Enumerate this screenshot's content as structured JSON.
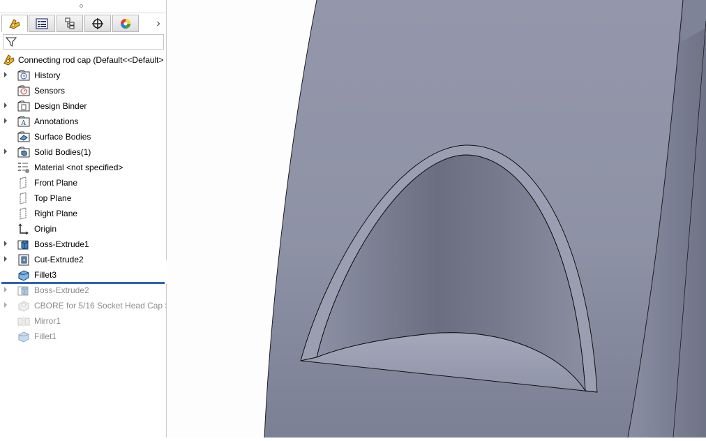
{
  "feature_manager": {
    "tabs": [
      {
        "name": "FeatureManager design tree",
        "icon": "feature-tree-icon"
      },
      {
        "name": "PropertyManager",
        "icon": "property-manager-icon"
      },
      {
        "name": "ConfigurationManager",
        "icon": "configuration-manager-icon"
      },
      {
        "name": "DimXpertManager",
        "icon": "dimxpert-icon"
      },
      {
        "name": "DisplayManager",
        "icon": "display-manager-icon"
      }
    ],
    "more_tabs_glyph": "›",
    "filter_icon": "filter-icon",
    "root_label": "Connecting rod cap  (Default<<Default>",
    "items": [
      {
        "label": "History",
        "icon": "history-folder-icon",
        "expandable": true,
        "suppressed": false
      },
      {
        "label": "Sensors",
        "icon": "sensors-folder-icon",
        "expandable": false,
        "suppressed": false
      },
      {
        "label": "Design Binder",
        "icon": "design-binder-icon",
        "expandable": true,
        "suppressed": false
      },
      {
        "label": "Annotations",
        "icon": "annotations-icon",
        "expandable": true,
        "suppressed": false
      },
      {
        "label": "Surface Bodies",
        "icon": "surface-bodies-icon",
        "expandable": false,
        "suppressed": false
      },
      {
        "label": "Solid Bodies(1)",
        "icon": "solid-bodies-icon",
        "expandable": true,
        "suppressed": false
      },
      {
        "label": "Material <not specified>",
        "icon": "material-icon",
        "expandable": false,
        "suppressed": false
      },
      {
        "label": "Front Plane",
        "icon": "plane-icon",
        "expandable": false,
        "suppressed": false
      },
      {
        "label": "Top Plane",
        "icon": "plane-icon",
        "expandable": false,
        "suppressed": false
      },
      {
        "label": "Right Plane",
        "icon": "plane-icon",
        "expandable": false,
        "suppressed": false
      },
      {
        "label": "Origin",
        "icon": "origin-icon",
        "expandable": false,
        "suppressed": false
      },
      {
        "label": "Boss-Extrude1",
        "icon": "boss-extrude-icon",
        "expandable": true,
        "suppressed": false
      },
      {
        "label": "Cut-Extrude2",
        "icon": "cut-extrude-icon",
        "expandable": true,
        "suppressed": false
      },
      {
        "label": "Fillet3",
        "icon": "fillet-icon",
        "expandable": false,
        "suppressed": false
      },
      {
        "label": "Boss-Extrude2",
        "icon": "boss-extrude-icon",
        "expandable": true,
        "suppressed": true
      },
      {
        "label": "CBORE for 5/16 Socket Head Cap Sc",
        "icon": "hole-wizard-icon",
        "expandable": true,
        "suppressed": true
      },
      {
        "label": "Mirror1",
        "icon": "mirror-icon",
        "expandable": false,
        "suppressed": true
      },
      {
        "label": "Fillet1",
        "icon": "fillet-icon",
        "expandable": false,
        "suppressed": true
      }
    ],
    "rollback_bar_color": "#2f63b8"
  },
  "viewport": {
    "model_color": "#8e93a6",
    "model_dark": "#6f7386"
  }
}
